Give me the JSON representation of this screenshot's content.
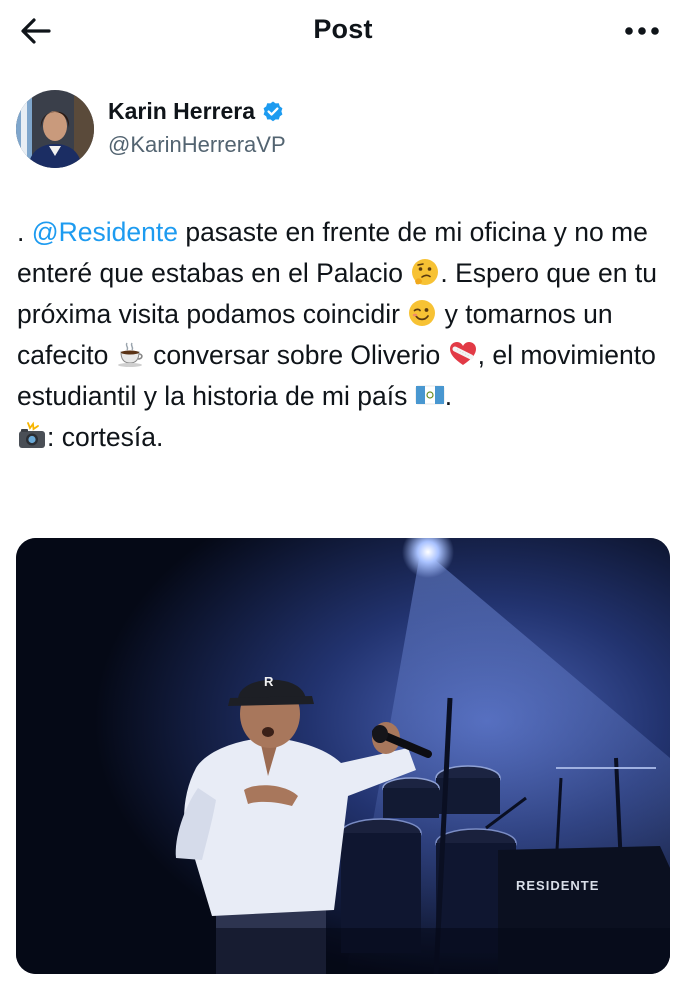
{
  "header": {
    "title": "Post",
    "back_icon": "arrow-left-icon",
    "more_icon": "more-horizontal-icon"
  },
  "author": {
    "name": "Karin Herrera",
    "handle": "@KarinHerreraVP",
    "verified": true,
    "verified_color": "#1d9bf0"
  },
  "tweet": {
    "lead": ". ",
    "mention": "@Residente",
    "text_1": " pasaste en frente de mi oficina y no me enteré que estabas en el Palacio ",
    "emoji_1": "thinking-face-emoji",
    "text_2": ". Espero que en tu próxima visita podamos coincidir ",
    "emoji_2": "winking-face-emoji",
    "text_3": " y tomarnos un cafecito ",
    "emoji_3": "hot-beverage-emoji",
    "text_4": " conversar sobre Oliverio ",
    "emoji_4": "mending-heart-emoji",
    "text_5": ", el movimiento estudiantil y la historia de mi país ",
    "emoji_5": "flag-guatemala-emoji",
    "text_6": ".",
    "emoji_6": "camera-flash-emoji",
    "text_7": ": cortesía."
  },
  "media": {
    "stage_sign": "RESIDENTE",
    "cap_letter": "R"
  },
  "colors": {
    "text": "#0f1419",
    "secondary": "#536471",
    "link": "#1d9bf0"
  }
}
